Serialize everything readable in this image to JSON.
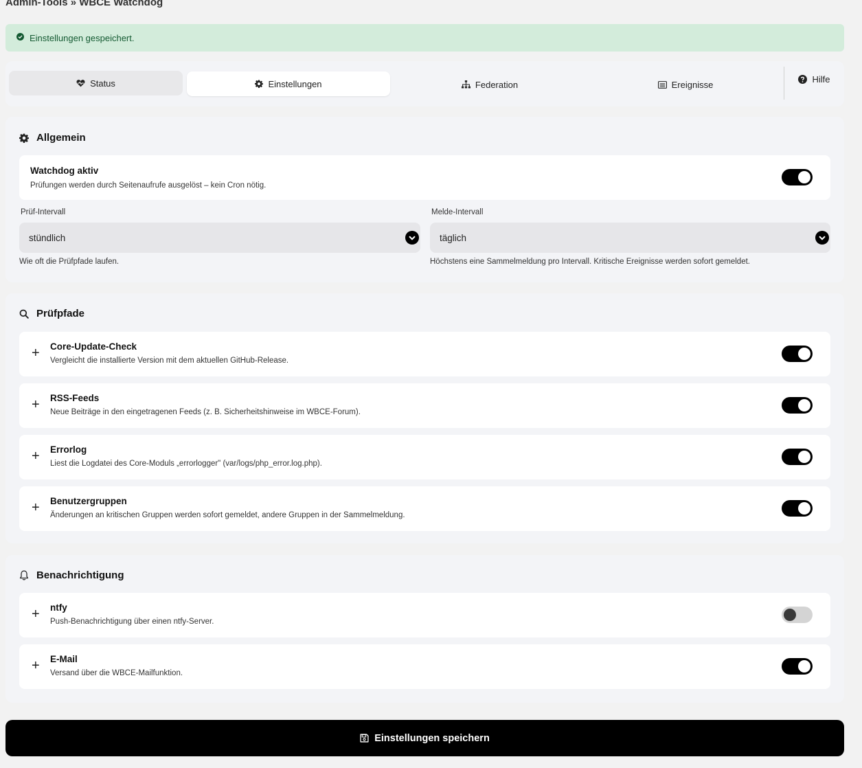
{
  "breadcrumb": "Admin-Tools » WBCE Watchdog",
  "alert": {
    "text": "Einstellungen gespeichert.",
    "color": "#d3ecdb"
  },
  "tabs": [
    {
      "label": "Status",
      "icon": "heart-pulse-icon"
    },
    {
      "label": "Einstellungen",
      "icon": "gear-icon",
      "active": true
    },
    {
      "label": "Federation",
      "icon": "sitemap-icon"
    },
    {
      "label": "Ereignisse",
      "icon": "list-icon"
    },
    {
      "label": "Hilfe",
      "icon": "question-circle-icon"
    }
  ],
  "general": {
    "title": "Allgemein",
    "watchdog": {
      "title": "Watchdog aktiv",
      "desc": "Prüfungen werden durch Seitenaufrufe ausgelöst – kein Cron nötig.",
      "enabled": true
    },
    "check_interval": {
      "label": "Prüf-Intervall",
      "value": "stündlich",
      "hint": "Wie oft die Prüfpfade laufen."
    },
    "report_interval": {
      "label": "Melde-Intervall",
      "value": "täglich",
      "hint": "Höchstens eine Sammelmeldung pro Intervall. Kritische Ereignisse werden sofort gemeldet."
    }
  },
  "paths": {
    "title": "Prüfpfade",
    "items": [
      {
        "title": "Core-Update-Check",
        "desc": "Vergleicht die installierte Version mit dem aktuellen GitHub-Release.",
        "enabled": true
      },
      {
        "title": "RSS-Feeds",
        "desc": "Neue Beiträge in den eingetragenen Feeds (z. B. Sicherheitshinweise im WBCE-Forum).",
        "enabled": true
      },
      {
        "title": "Errorlog",
        "desc": "Liest die Logdatei des Core-Moduls „errorlogger\" (var/logs/php_error.log.php).",
        "enabled": true
      },
      {
        "title": "Benutzergruppen",
        "desc": "Änderungen an kritischen Gruppen werden sofort gemeldet, andere Gruppen in der Sammelmeldung.",
        "enabled": true
      }
    ]
  },
  "notify": {
    "title": "Benachrichtigung",
    "items": [
      {
        "title": "ntfy",
        "desc": "Push-Benachrichtigung über einen ntfy-Server.",
        "enabled": false
      },
      {
        "title": "E-Mail",
        "desc": "Versand über die WBCE-Mailfunktion.",
        "enabled": true
      }
    ]
  },
  "save_button": "Einstellungen speichern",
  "colors": {
    "accent": "#000000",
    "background": "#f2f2f2",
    "card": "#f3f4f7"
  }
}
